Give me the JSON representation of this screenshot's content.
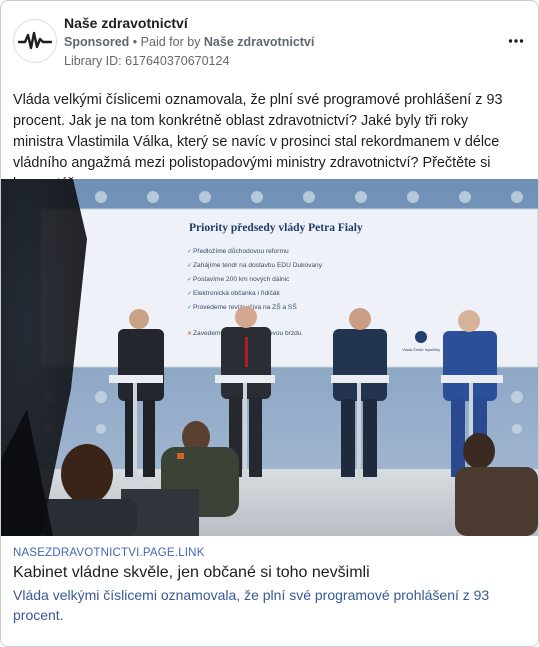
{
  "ad": {
    "page_name": "Naše zdravotnictví",
    "sponsored_label": "Sponsored",
    "separator": "•",
    "paid_for_prefix": "Paid for by",
    "paid_for_name": "Naše zdravotnictví",
    "library_id": "Library ID: 617640370670124",
    "more_icon": "more-options-icon",
    "body_text": "Vláda velkými číslicemi oznamovala, že plní své programové prohlášení z 93 procent. Jak je na tom konkrétně oblast zdravotnictví? Jaké byly tři roky ministra Vlastimila Válka, který se navíc v prosinci stal rekordmanem v délce vládního angažmá mezi polistopadovými ministry zdravotnictví? Přečtěte si komentář."
  },
  "photo": {
    "slide_title": "Priority předsedy vlády Petra Fialy",
    "slide_items": [
      "Předložíme důchodovou reformu",
      "Zahájíme tendr na dostavbu EDU Dukovany",
      "Postavíme 200 km nových dálnic",
      "Elektronická občanka i řidičák",
      "Provedeme revizi učiva na ZŠ a SŠ"
    ],
    "slide_crossed": "Zavedeme komplexní daňovou brzdu",
    "slide_logo_text": "Vláda České republiky"
  },
  "link": {
    "domain": "NASEZDRAVOTNICTVI.PAGE.LINK",
    "title": "Kabinet vládne skvěle, jen občané si toho nevšimli",
    "description": "Vláda velkými číslicemi oznamovala, že plní své programové prohlášení z 93 procent."
  }
}
